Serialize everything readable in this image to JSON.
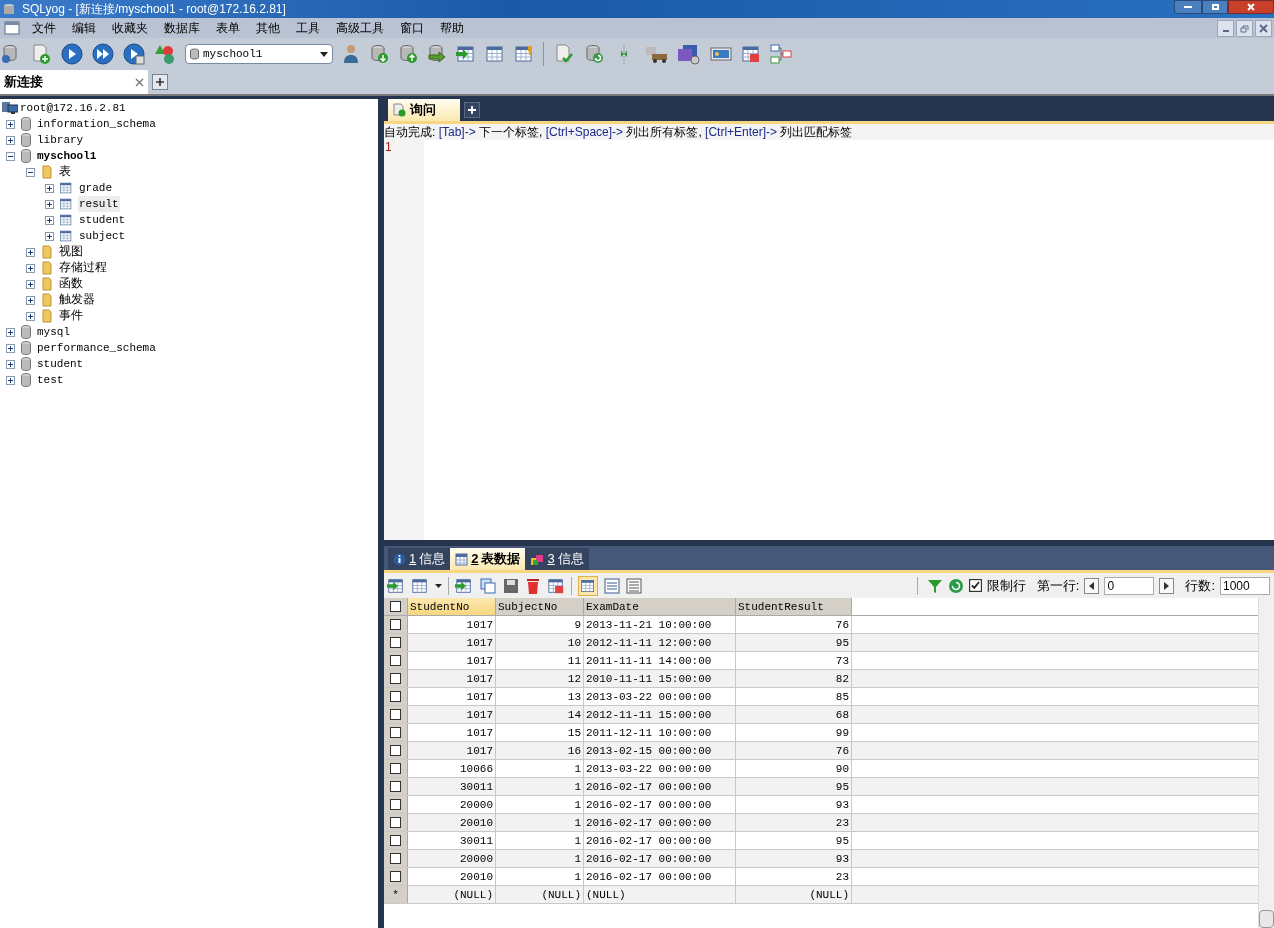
{
  "window": {
    "title": "SQLyog - [新连接/myschool1 - root@172.16.2.81]"
  },
  "menu": [
    "文件",
    "编辑",
    "收藏夹",
    "数据库",
    "表单",
    "其他",
    "工具",
    "高级工具",
    "窗口",
    "帮助"
  ],
  "toolbar": {
    "database_select": "myschool1"
  },
  "connection_tabs": [
    {
      "label": "新连接",
      "selected": true
    }
  ],
  "tree": {
    "root": "root@172.16.2.81",
    "databases": [
      {
        "name": "information_schema",
        "active": false,
        "expanded": false
      },
      {
        "name": "library",
        "active": false,
        "expanded": false
      },
      {
        "name": "myschool1",
        "active": true,
        "expanded": true,
        "folders": [
          {
            "name": "表",
            "expanded": true,
            "tables": [
              {
                "name": "grade",
                "selected": false
              },
              {
                "name": "result",
                "selected": true
              },
              {
                "name": "student",
                "selected": false
              },
              {
                "name": "subject",
                "selected": false
              }
            ]
          },
          {
            "name": "视图",
            "expanded": false
          },
          {
            "name": "存储过程",
            "expanded": false
          },
          {
            "name": "函数",
            "expanded": false
          },
          {
            "name": "触发器",
            "expanded": false
          },
          {
            "name": "事件",
            "expanded": false
          }
        ]
      },
      {
        "name": "mysql",
        "active": false,
        "expanded": false
      },
      {
        "name": "performance_schema",
        "active": false,
        "expanded": false
      },
      {
        "name": "student",
        "active": false,
        "expanded": false
      },
      {
        "name": "test",
        "active": false,
        "expanded": false
      }
    ]
  },
  "query_tabs": [
    {
      "label": "询问",
      "selected": true
    }
  ],
  "autocomplete_hint": [
    {
      "kind": "text",
      "text": "自动完成: "
    },
    {
      "kind": "key",
      "text": "[Tab]-> "
    },
    {
      "kind": "text",
      "text": "下一个标签, "
    },
    {
      "kind": "key",
      "text": "[Ctrl+Space]-> "
    },
    {
      "kind": "text",
      "text": "列出所有标签, "
    },
    {
      "kind": "key",
      "text": "[Ctrl+Enter]-> "
    },
    {
      "kind": "text",
      "text": "列出匹配标签"
    }
  ],
  "editor": {
    "line_numbers": [
      "1"
    ]
  },
  "result_tabs": [
    {
      "number": "1",
      "label": "信息",
      "selected": false
    },
    {
      "number": "2",
      "label": "表数据",
      "selected": true
    },
    {
      "number": "3",
      "label": "信息",
      "selected": false
    }
  ],
  "result_toolbar": {
    "limit": {
      "label": "限制行",
      "checked": true
    },
    "first_row": {
      "label": "第一行:",
      "value": "0"
    },
    "row_count": {
      "label": "行数:",
      "value": "1000"
    }
  },
  "grid": {
    "header_checked": false,
    "columns": [
      {
        "name": "StudentNo",
        "selected": true
      },
      {
        "name": "SubjectNo",
        "selected": false
      },
      {
        "name": "ExamDate",
        "selected": false
      },
      {
        "name": "StudentResult",
        "selected": false
      }
    ],
    "rows": [
      {
        "checked": false,
        "cells": [
          "1017",
          "9",
          "2013-11-21 10:00:00",
          "76"
        ]
      },
      {
        "checked": false,
        "cells": [
          "1017",
          "10",
          "2012-11-11 12:00:00",
          "95"
        ]
      },
      {
        "checked": false,
        "cells": [
          "1017",
          "11",
          "2011-11-11 14:00:00",
          "73"
        ]
      },
      {
        "checked": false,
        "cells": [
          "1017",
          "12",
          "2010-11-11 15:00:00",
          "82"
        ]
      },
      {
        "checked": false,
        "cells": [
          "1017",
          "13",
          "2013-03-22 00:00:00",
          "85"
        ]
      },
      {
        "checked": false,
        "cells": [
          "1017",
          "14",
          "2012-11-11 15:00:00",
          "68"
        ]
      },
      {
        "checked": false,
        "cells": [
          "1017",
          "15",
          "2011-12-11 10:00:00",
          "99"
        ]
      },
      {
        "checked": false,
        "cells": [
          "1017",
          "16",
          "2013-02-15 00:00:00",
          "76"
        ]
      },
      {
        "checked": false,
        "cells": [
          "10066",
          "1",
          "2013-03-22 00:00:00",
          "90"
        ]
      },
      {
        "checked": false,
        "cells": [
          "30011",
          "1",
          "2016-02-17 00:00:00",
          "95"
        ]
      },
      {
        "checked": false,
        "cells": [
          "20000",
          "1",
          "2016-02-17 00:00:00",
          "93"
        ]
      },
      {
        "checked": false,
        "cells": [
          "20010",
          "1",
          "2016-02-17 00:00:00",
          "23"
        ]
      },
      {
        "checked": false,
        "cells": [
          "30011",
          "1",
          "2016-02-17 00:00:00",
          "95"
        ]
      },
      {
        "checked": false,
        "cells": [
          "20000",
          "1",
          "2016-02-17 00:00:00",
          "93"
        ]
      },
      {
        "checked": false,
        "cells": [
          "20010",
          "1",
          "2016-02-17 00:00:00",
          "23"
        ]
      }
    ],
    "new_row": {
      "marker": "*",
      "cells": [
        "(NULL)",
        "(NULL)",
        "(NULL)",
        "(NULL)"
      ]
    }
  }
}
